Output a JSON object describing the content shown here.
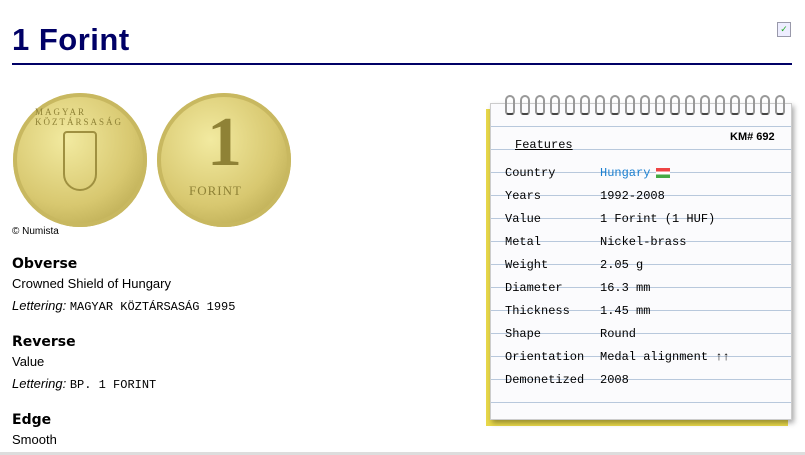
{
  "title": "1 Forint",
  "copyright": "© Numista",
  "coin_images": {
    "obverse_text": "MAGYAR KÖZTÁRSASÁG",
    "reverse_numeral": "1",
    "reverse_word": "FORINT"
  },
  "obverse": {
    "heading": "Obverse",
    "description": "Crowned Shield of Hungary",
    "lettering_label": "Lettering:",
    "lettering": "MAGYAR KÖZTÁRSASÁG 1995"
  },
  "reverse": {
    "heading": "Reverse",
    "description": "Value",
    "lettering_label": "Lettering:",
    "lettering": "BP. 1 FORINT"
  },
  "edge": {
    "heading": "Edge",
    "description": "Smooth"
  },
  "features": {
    "heading": "Features",
    "km": "KM# 692",
    "rows": [
      {
        "label": "Country",
        "value": "Hungary"
      },
      {
        "label": "Years",
        "value": "1992-2008"
      },
      {
        "label": "Value",
        "value": "1 Forint (1 HUF)"
      },
      {
        "label": "Metal",
        "value": "Nickel-brass"
      },
      {
        "label": "Weight",
        "value": "2.05 g"
      },
      {
        "label": "Diameter",
        "value": "16.3 mm"
      },
      {
        "label": "Thickness",
        "value": "1.45 mm"
      },
      {
        "label": "Shape",
        "value": "Round"
      },
      {
        "label": "Orientation",
        "value": "Medal alignment ↑↑"
      },
      {
        "label": "Demonetized",
        "value": "2008"
      }
    ]
  },
  "colors": {
    "title": "#000066",
    "link": "#1a7fd0"
  }
}
